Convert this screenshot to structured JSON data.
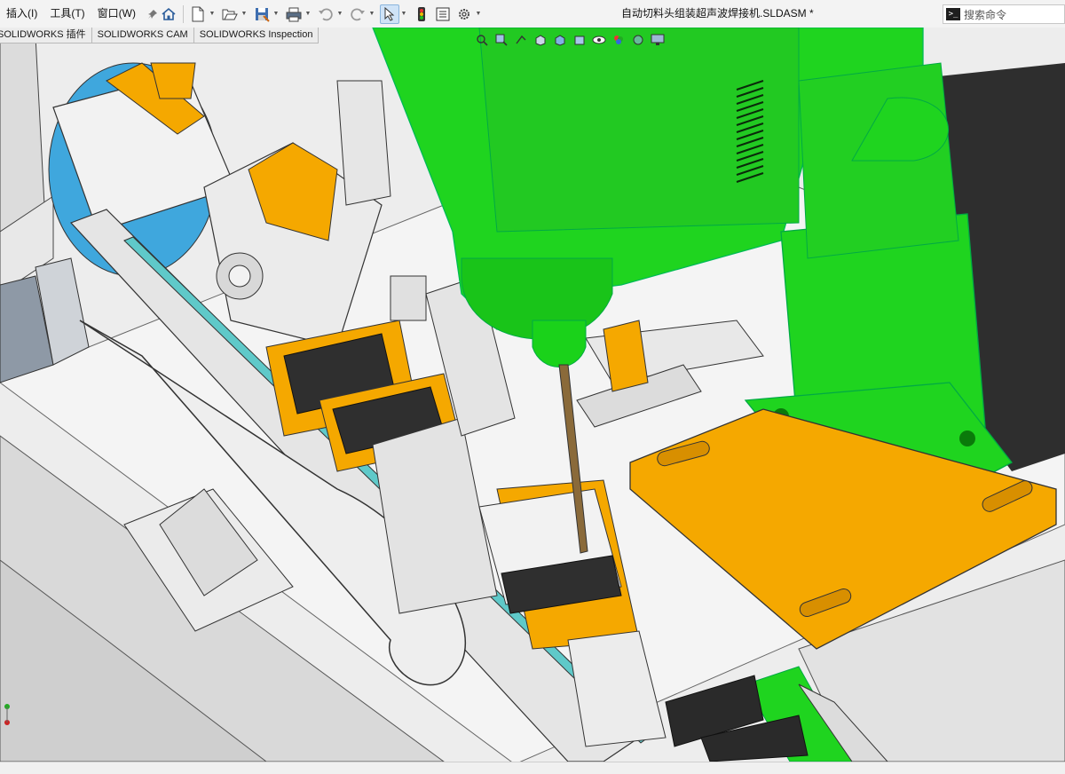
{
  "menu": {
    "items": [
      {
        "label": "插入(I)"
      },
      {
        "label": "工具(T)"
      },
      {
        "label": "窗口(W)"
      }
    ]
  },
  "toolbar": {
    "buttons": [
      "home-icon",
      "new-document-icon",
      "open-icon",
      "save-icon",
      "print-icon",
      "undo-icon",
      "redo-icon",
      "select-icon",
      "traffic-light-icon",
      "options-list-icon",
      "gear-icon"
    ]
  },
  "document": {
    "title": "自动切料头组装超声波焊接机.SLDASM *"
  },
  "search": {
    "placeholder": "搜索命令"
  },
  "tabs": [
    {
      "label": "SOLIDWORKS 插件"
    },
    {
      "label": "SOLIDWORKS CAM"
    },
    {
      "label": "SOLIDWORKS Inspection"
    }
  ],
  "colors": {
    "green": "#1fd41f",
    "orange": "#f5a800",
    "part_gray": "#e6e6e6",
    "dark_gray": "#3d3d3d"
  }
}
